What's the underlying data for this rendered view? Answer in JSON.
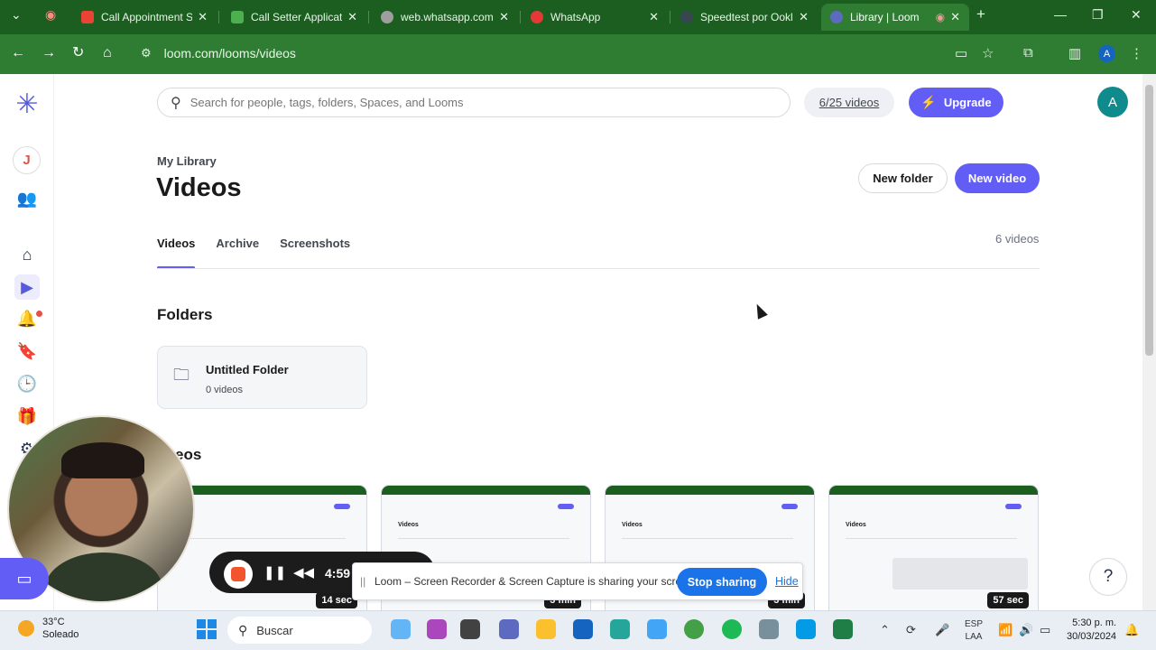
{
  "browser": {
    "tabs": [
      {
        "title": "Call Appointment S",
        "color": "#ea4335"
      },
      {
        "title": "Call Setter Applicati",
        "color": "#4caf50"
      },
      {
        "title": "web.whatsapp.com",
        "color": "#9e9e9e"
      },
      {
        "title": "WhatsApp",
        "color": "#e53935"
      },
      {
        "title": "Speedtest por Ookl",
        "color": "#37474f"
      },
      {
        "title": "Library | Loom",
        "color": "#5c6bc0"
      }
    ],
    "url": "loom.com/looms/videos",
    "profile_initial": "A"
  },
  "rail": {
    "workspace_initial": "J"
  },
  "topbar": {
    "search_placeholder": "Search for people, tags, folders, Spaces, and Looms",
    "video_counter": "6/25 videos",
    "upgrade_label": "Upgrade",
    "avatar_initial": "A"
  },
  "header": {
    "breadcrumb": "My Library",
    "title": "Videos",
    "new_folder_label": "New folder",
    "new_video_label": "New video",
    "tabs": [
      "Videos",
      "Archive",
      "Screenshots"
    ],
    "count": "6 videos"
  },
  "folders": {
    "heading": "Folders",
    "items": [
      {
        "name": "Untitled Folder",
        "count": "0 videos"
      }
    ]
  },
  "videos": {
    "heading": "Videos",
    "heading_visible": "eos",
    "durations": [
      "14 sec",
      "3 min",
      "3 min",
      "57 sec"
    ]
  },
  "recorder": {
    "time": "4:59"
  },
  "share_bar": {
    "message": "Loom – Screen Recorder & Screen Capture is sharing your screen.",
    "stop_label": "Stop sharing",
    "hide_label": "Hide"
  },
  "taskbar": {
    "temperature": "33°C",
    "condition": "Soleado",
    "search_placeholder": "Buscar",
    "lang_top": "ESP",
    "lang_bottom": "LAA",
    "time": "5:30 p. m.",
    "date": "30/03/2024"
  }
}
